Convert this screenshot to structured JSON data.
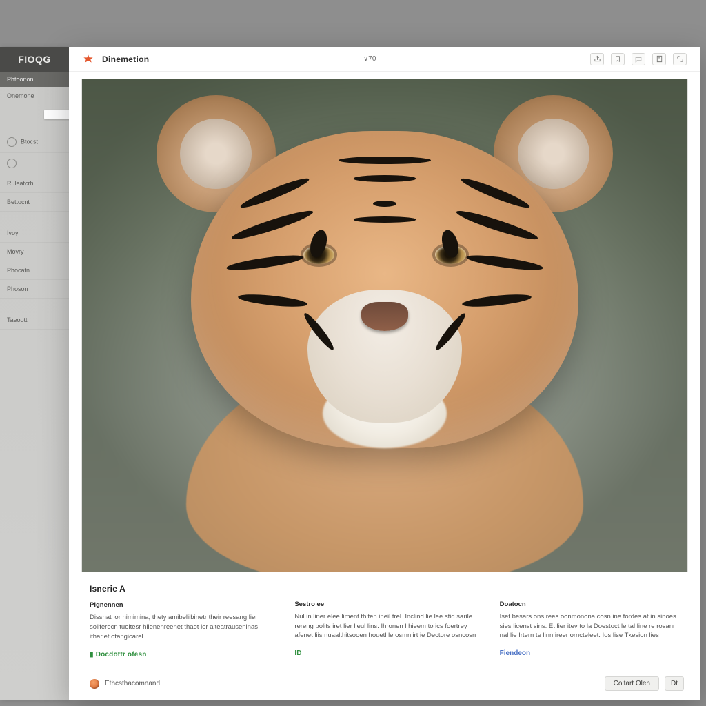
{
  "brand": "FIOQG",
  "sidebar": {
    "active": "Phtoonon",
    "items": [
      "Onemone",
      "Btocst",
      "Ruleatcrh",
      "Bettocnt",
      "Ivoy",
      "Movry",
      "Phocatn",
      "Phoson",
      "Taeoott"
    ]
  },
  "header": {
    "title": "Dinemetion",
    "center_badge": "∨70",
    "actions": [
      "share-icon",
      "bookmark-icon",
      "message-icon",
      "export-icon",
      "expand-icon"
    ]
  },
  "image": {
    "title": "Isnerie A",
    "alt": "Tiger portrait"
  },
  "info": {
    "col1": {
      "heading": "Pignennen",
      "body": "Dissnat ior himimina, thety amibeliibinetr their reesang lier soliferecn tuoitesr hiienenreenet thaot ler alteatrauseninas ithariet otangicarel",
      "tag": "Docdottr ofesn"
    },
    "col2": {
      "heading": "Sestro ee",
      "body": "Nul in liner elee liment thiten ineil trel. Inclind lie lee stid sarile rereng bolits iret lier lieul lins. Ihronen l hieem to ics foertrey afenet liis nuaalthitsooen houetl le osmnlirt ie Dectore osncosn",
      "tag": "ID"
    },
    "col3": {
      "heading": "Doatocn",
      "body": "Iset besars ons rees oonmonona cosn ine fordes at in sinoes sies licenst sins. Et lier itev to la Doestoct le tal line re rosanr nal lie Irtern te linn ireer orncteleet. Ios lise Tkesion lies",
      "tag": "Fiendeon"
    }
  },
  "footer": {
    "source": "Ethcsthacomnand",
    "primary_btn": "Coltart Olen",
    "secondary_btn": "Dt"
  }
}
